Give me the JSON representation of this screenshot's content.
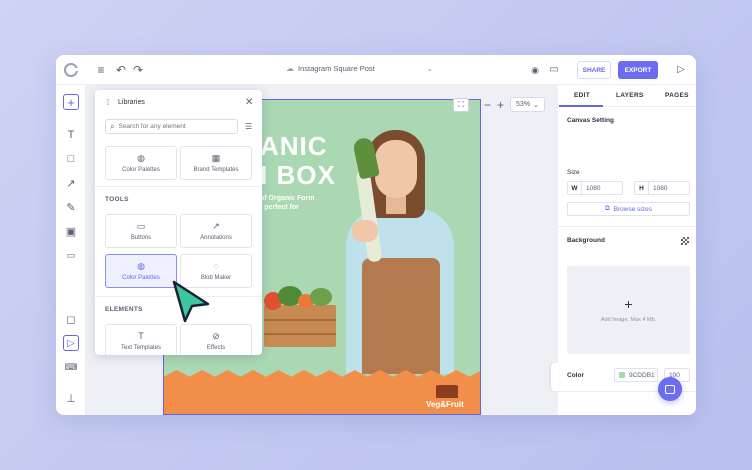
{
  "topbar": {
    "doc_title": "Instagram Square Post",
    "share_label": "SHARE",
    "export_label": "EXPORT"
  },
  "libraries": {
    "title": "Libraries",
    "search_placeholder": "Search for any element",
    "top_tiles": [
      {
        "label": "Color Palettes",
        "icon": "palette-icon"
      },
      {
        "label": "Brand Templates",
        "icon": "brand-templates-icon"
      }
    ],
    "tools_heading": "TOOLS",
    "tools": [
      {
        "label": "Buttons",
        "icon": "button-icon"
      },
      {
        "label": "Annotations",
        "icon": "arrow-icon"
      },
      {
        "label": "Color Palettes",
        "icon": "palette-icon"
      },
      {
        "label": "Blob Maker",
        "icon": "blob-icon"
      }
    ],
    "elements_heading": "ELEMENTS",
    "elements": [
      {
        "label": "Text Templates",
        "icon": "text-template-icon"
      },
      {
        "label": "Effects",
        "icon": "effects-icon"
      }
    ]
  },
  "canvas": {
    "zoom": "53%",
    "headline_line1": "ANIC",
    "headline_line2": "I BOX",
    "subline1": "of Organic Form",
    "subline2": "t perfect for",
    "brand": "Veg&Fruit"
  },
  "right_panel": {
    "tabs": [
      "EDIT",
      "LAYERS",
      "PAGES"
    ],
    "canvas_setting": "Canvas Setting",
    "size_label": "Size",
    "width_key": "W",
    "width_value": "1080",
    "height_key": "H",
    "height_value": "1080",
    "browse_label": "Browse sizes",
    "background_label": "Background",
    "add_image": "Add Image. Max 4 Mb.",
    "color_label": "Color",
    "color_value": "9CDDB1",
    "opacity_value": "100"
  },
  "colors": {
    "accent": "#6c6cf0",
    "design_bg": "#a9d8b3",
    "design_bottom": "#f18f4a",
    "swatch": "#9cddb1"
  }
}
